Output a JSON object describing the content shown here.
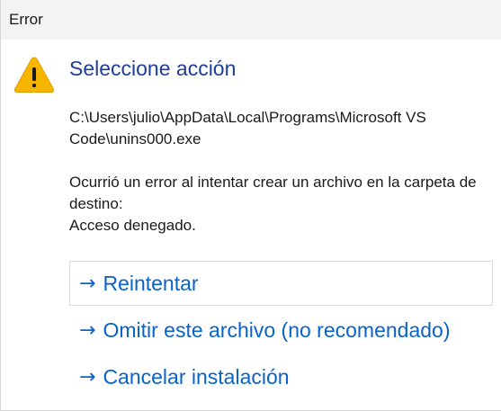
{
  "window": {
    "title": "Error"
  },
  "icon": {
    "name": "warning-icon",
    "fill_color": "#f7b500",
    "mark_color": "#1a1a1a"
  },
  "dialog": {
    "heading": "Seleccione acción",
    "path_line1": "C:\\Users\\julio\\AppData\\Local\\Programs\\Microsoft VS",
    "path_line2": "Code\\unins000.exe",
    "message_line1": "Ocurrió un error al intentar crear un archivo en la carpeta de",
    "message_line2": "destino:",
    "message_line3": "Acceso denegado."
  },
  "commands": [
    {
      "arrow": "→",
      "label": "Reintentar",
      "focused": true
    },
    {
      "arrow": "→",
      "label": "Omitir este archivo (no recomendado)",
      "focused": false
    },
    {
      "arrow": "→",
      "label": "Cancelar instalación",
      "focused": false
    }
  ],
  "colors": {
    "heading": "#1f3d9a",
    "command_link": "#0a63c9",
    "titlebar_bg": "#f3f3f3"
  }
}
